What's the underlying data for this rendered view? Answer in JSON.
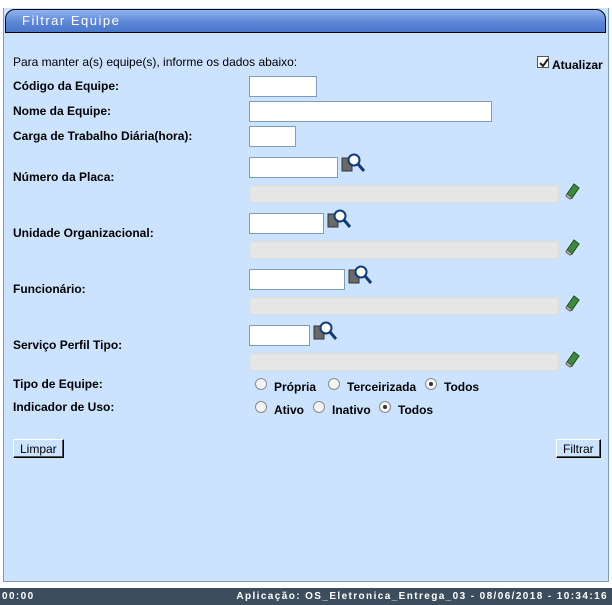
{
  "window": {
    "title": "Filtrar Equipe"
  },
  "form": {
    "instructions": "Para manter a(s) equipe(s), informe os dados abaixo:",
    "atualizar": {
      "label": "Atualizar",
      "checked": true
    },
    "codigo": {
      "label": "Código da Equipe:",
      "value": ""
    },
    "nome": {
      "label": "Nome da Equipe:",
      "value": ""
    },
    "carga": {
      "label": "Carga de Trabalho Diária(hora):",
      "value": ""
    },
    "placa": {
      "label": "Número da Placa:",
      "value": ""
    },
    "unidade": {
      "label": "Unidade Organizacional:",
      "value": ""
    },
    "funcionario": {
      "label": "Funcionário:",
      "value": ""
    },
    "servico": {
      "label": "Serviço Perfil Tipo:",
      "value": ""
    },
    "tipo_equipe": {
      "label": "Tipo de Equipe:",
      "options": [
        "Própria",
        "Terceirizada",
        "Todos"
      ],
      "selected": "Todos"
    },
    "indicador_uso": {
      "label": "Indicador de Uso:",
      "options": [
        "Ativo",
        "Inativo",
        "Todos"
      ],
      "selected": "Todos"
    }
  },
  "buttons": {
    "limpar": "Limpar",
    "filtrar": "Filtrar"
  },
  "icons": {
    "search": "magnifier-search-icon",
    "clear": "eraser-icon"
  },
  "statusbar": {
    "left": "00:00",
    "right": "Aplicação: OS_Eletronica_Entrega_03 - 08/06/2018 - 10:34:16"
  }
}
